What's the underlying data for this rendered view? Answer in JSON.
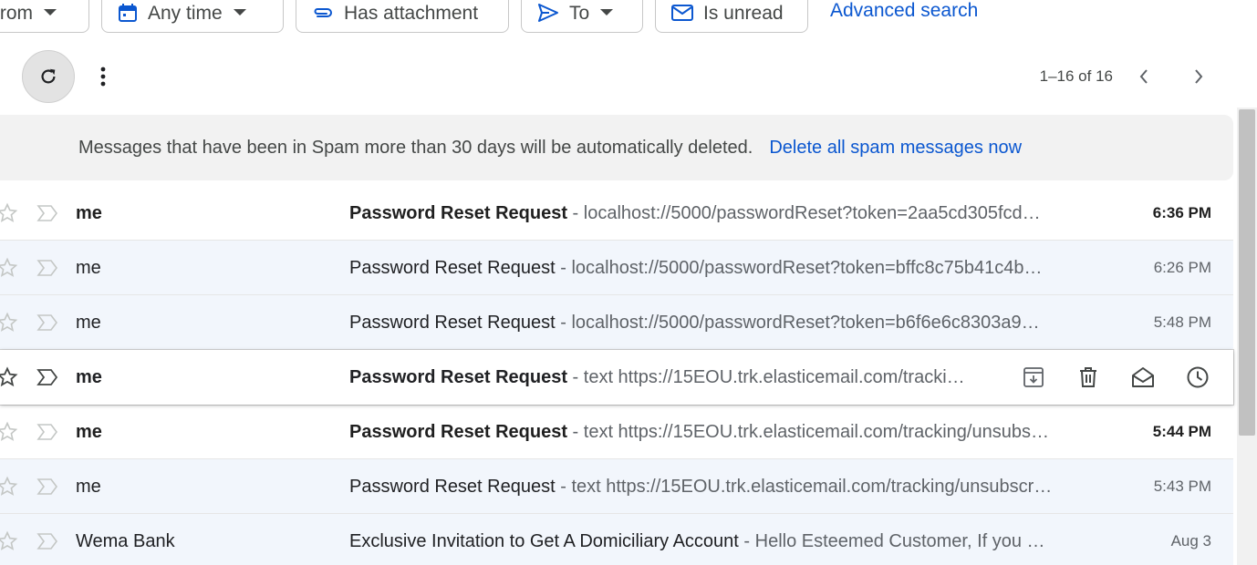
{
  "filters": {
    "from_label": "From",
    "any_time_label": "Any time",
    "has_attachment_label": "Has attachment",
    "to_label": "To",
    "is_unread_label": "Is unread",
    "advanced_search_label": "Advanced search"
  },
  "toolbar": {
    "pagination": "1–16 of 16"
  },
  "banner": {
    "message": "Messages that have been in Spam more than 30 days will be automatically deleted.",
    "action": "Delete all spam messages now"
  },
  "emails": [
    {
      "sender": "me",
      "subject": "Password Reset Request",
      "snippet": " - localhost://5000/passwordReset?token=2aa5cd305fcd…",
      "time": "6:36 PM",
      "unread": true
    },
    {
      "sender": "me",
      "subject": "Password Reset Request",
      "snippet": " - localhost://5000/passwordReset?token=bffc8c75b41c4b…",
      "time": "6:26 PM",
      "unread": false
    },
    {
      "sender": "me",
      "subject": "Password Reset Request",
      "snippet": " - localhost://5000/passwordReset?token=b6f6e6c8303a9…",
      "time": "5:48 PM",
      "unread": false
    },
    {
      "sender": "me",
      "subject": "Password Reset Request",
      "snippet": " - text https://15EOU.trk.elasticemail.com/tracki…",
      "time": "",
      "unread": true
    },
    {
      "sender": "me",
      "subject": "Password Reset Request",
      "snippet": " - text https://15EOU.trk.elasticemail.com/tracking/unsubs…",
      "time": "5:44 PM",
      "unread": true
    },
    {
      "sender": "me",
      "subject": "Password Reset Request",
      "snippet": " - text https://15EOU.trk.elasticemail.com/tracking/unsubscr…",
      "time": "5:43 PM",
      "unread": false
    },
    {
      "sender": "Wema Bank",
      "subject": "Exclusive Invitation to Get A Domiciliary Account",
      "snippet": " - Hello Esteemed Customer, If you …",
      "time": "Aug 3",
      "unread": false
    }
  ],
  "icons": {
    "chip_from": "chevron-down-icon",
    "any_time": "calendar-icon",
    "attachment": "paperclip-icon",
    "to": "send-icon",
    "unread": "mail-icon",
    "refresh": "refresh-icon",
    "more": "more-vert-icon",
    "prev": "chevron-left-icon",
    "next": "chevron-right-icon",
    "star": "star-icon",
    "important": "important-marker-icon",
    "archive": "archive-icon",
    "delete": "trash-icon",
    "mark_read": "open-mail-icon",
    "snooze": "clock-icon"
  },
  "colors": {
    "link": "#0b57d0",
    "read_row_bg": "#f2f6fc",
    "banner_bg": "#f2f2f2"
  }
}
